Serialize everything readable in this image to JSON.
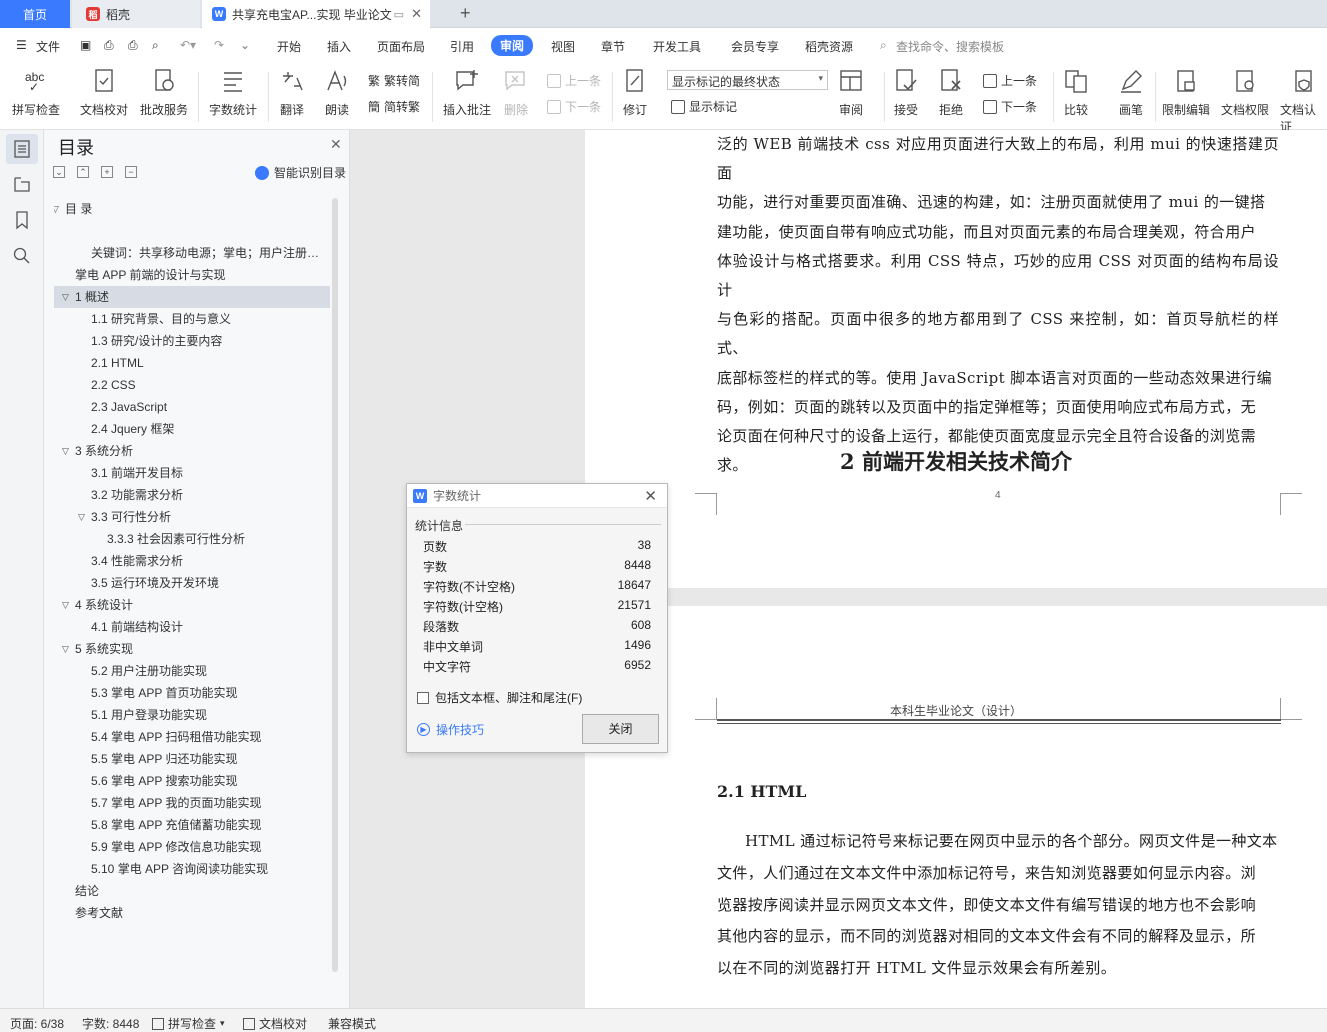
{
  "tabs": {
    "home": "首页",
    "daoke": "稻壳",
    "doc": "共享充电宝AP...实现 毕业论文"
  },
  "menu": {
    "file": "文件",
    "items": [
      "开始",
      "插入",
      "页面布局",
      "引用",
      "审阅",
      "视图",
      "章节",
      "开发工具",
      "会员专享",
      "稻壳资源"
    ],
    "active": "审阅",
    "search": "查找命令、搜索模板"
  },
  "ribbon": {
    "spell": "拼写检查",
    "proof": "文档校对",
    "batch": "批改服务",
    "wordcount": "字数统计",
    "translate": "翻译",
    "read": "朗读",
    "trad": "繁转简",
    "simp": "简转繁",
    "insert_comment": "插入批注",
    "delete": "删除",
    "prev": "上一条",
    "next": "下一条",
    "revise": "修订",
    "status_select": "显示标记的最终状态",
    "show_marks": "显示标记",
    "review": "审阅",
    "accept": "接受",
    "reject": "拒绝",
    "prev2": "上一条",
    "next2": "下一条",
    "compare": "比较",
    "pen": "画笔",
    "restrict": "限制编辑",
    "rights": "文档权限",
    "certify": "文档认证"
  },
  "toc": {
    "title": "目录",
    "smart": "智能识别目录",
    "items": [
      {
        "text": "目 录",
        "level": 0,
        "arrow": "down"
      },
      {
        "text": "",
        "level": 0
      },
      {
        "text": "关键词：共享移动电源；掌电；用户注册…",
        "level": 2
      },
      {
        "text": "掌电 APP 前端的设计与实现",
        "level": 1
      },
      {
        "text": "1  概述",
        "level": 1,
        "arrow": "down",
        "selected": true
      },
      {
        "text": "1.1  研究背景、目的与意义",
        "level": 2
      },
      {
        "text": "1.3  研究/设计的主要内容",
        "level": 2
      },
      {
        "text": "2.1 HTML",
        "level": 2
      },
      {
        "text": "2.2 CSS",
        "level": 2
      },
      {
        "text": "2.3 JavaScript",
        "level": 2
      },
      {
        "text": "2.4 Jquery 框架",
        "level": 2
      },
      {
        "text": "3  系统分析",
        "level": 1,
        "arrow": "down"
      },
      {
        "text": "3.1  前端开发目标",
        "level": 2
      },
      {
        "text": "3.2  功能需求分析",
        "level": 2
      },
      {
        "text": "3.3  可行性分析",
        "level": 2,
        "arrow": "down"
      },
      {
        "text": "3.3.3  社会因素可行性分析",
        "level": 3
      },
      {
        "text": "3.4  性能需求分析",
        "level": 2
      },
      {
        "text": "3.5  运行环境及开发环境",
        "level": 2
      },
      {
        "text": "4  系统设计",
        "level": 1,
        "arrow": "down"
      },
      {
        "text": "4.1  前端结构设计",
        "level": 2
      },
      {
        "text": "5  系统实现",
        "level": 1,
        "arrow": "down"
      },
      {
        "text": "5.2  用户注册功能实现",
        "level": 2
      },
      {
        "text": "5.3  掌电 APP 首页功能实现",
        "level": 2
      },
      {
        "text": "5.1 用户登录功能实现",
        "level": 2
      },
      {
        "text": "5.4  掌电 APP 扫码租借功能实现",
        "level": 2
      },
      {
        "text": "5.5  掌电 APP 归还功能实现",
        "level": 2
      },
      {
        "text": "5.6  掌电 APP 搜索功能实现",
        "level": 2
      },
      {
        "text": "5.7  掌电 APP 我的页面功能实现",
        "level": 2
      },
      {
        "text": "5.8  掌电 APP 充值储蓄功能实现",
        "level": 2
      },
      {
        "text": "5.9  掌电 APP 修改信息功能实现",
        "level": 2
      },
      {
        "text": "5.10  掌电 APP 咨询阅读功能实现",
        "level": 2
      },
      {
        "text": "结论",
        "level": 1
      },
      {
        "text": "参考文献",
        "level": 1
      }
    ]
  },
  "doc": {
    "lines1": [
      "泛的 WEB 前端技术 css 对应用页面进行大致上的布局，利用 mui 的快速搭建页面",
      "功能，进行对重要页面准确、迅速的构建，如：注册页面就使用了 mui 的一键搭",
      "建功能，使页面自带有响应式功能，而且对页面元素的布局合理美观，符合用户",
      "体验设计与格式搭要求。利用 CSS 特点，巧妙的应用 CSS 对页面的结构布局设计",
      "与色彩的搭配。页面中很多的地方都用到了 CSS 来控制，如：首页导航栏的样式、",
      "底部标签栏的样式的等。使用 JavaScript 脚本语言对页面的一些动态效果进行编",
      "码，例如：页面的跳转以及页面中的指定弹框等；页面使用响应式布局方式，无",
      "论页面在何种尺寸的设备上运行，都能使页面宽度显示完全且符合设备的浏览需",
      "求。"
    ],
    "heading2": "2  前端开发相关技术简介",
    "page_number": "4",
    "page_header": "本科生毕业论文（设计）",
    "heading21": "2.1 HTML",
    "lines2": [
      "HTML 通过标记符号来标记要在网页中显示的各个部分。网页文件是一种文本",
      "文件，人们通过在文本文件中添加标记符号，来告知浏览器要如何显示内容。浏",
      "览器按序阅读并显示网页文本文件，即使文本文件有编写错误的地方也不会影响",
      "其他内容的显示，而不同的浏览器对相同的文本文件会有不同的解释及显示，所",
      "以在不同的浏览器打开 HTML 文件显示效果会有所差别。"
    ]
  },
  "dialog": {
    "title": "字数统计",
    "section": "统计信息",
    "stats": [
      {
        "label": "页数",
        "value": "38"
      },
      {
        "label": "字数",
        "value": "8448"
      },
      {
        "label": "字符数(不计空格)",
        "value": "18647"
      },
      {
        "label": "字符数(计空格)",
        "value": "21571"
      },
      {
        "label": "段落数",
        "value": "608"
      },
      {
        "label": "非中文单词",
        "value": "1496"
      },
      {
        "label": "中文字符",
        "value": "6952"
      }
    ],
    "checkbox": "包括文本框、脚注和尾注(F)",
    "tips": "操作技巧",
    "close": "关闭"
  },
  "status": {
    "page": "页面: 6/38",
    "words": "字数: 8448",
    "spell": "拼写检查",
    "proof": "文档校对",
    "compat": "兼容模式"
  },
  "colors": {
    "accent": "#3a7afe",
    "daoke_red": "#e53935"
  }
}
